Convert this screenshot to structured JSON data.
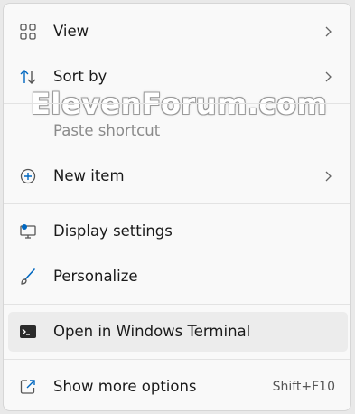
{
  "menu": {
    "items": [
      {
        "label": "View",
        "icon": "grid-icon",
        "submenu": true
      },
      {
        "label": "Sort by",
        "icon": "sort-arrows-icon",
        "submenu": true
      },
      {
        "label": "Paste shortcut",
        "disabled": true
      },
      {
        "label": "New item",
        "icon": "plus-circle-icon",
        "submenu": true
      },
      {
        "label": "Display settings",
        "icon": "display-icon"
      },
      {
        "label": "Personalize",
        "icon": "brush-icon"
      },
      {
        "label": "Open in Windows Terminal",
        "icon": "terminal-icon",
        "hovered": true
      },
      {
        "label": "Show more options",
        "icon": "open-external-icon",
        "shortcut": "Shift+F10"
      }
    ]
  },
  "watermark": "ElevenForum.com",
  "colors": {
    "accent": "#0067c0",
    "menu_bg": "#f9f9f9",
    "hover_bg": "#ececec",
    "disabled_text": "#8a8a8a"
  }
}
